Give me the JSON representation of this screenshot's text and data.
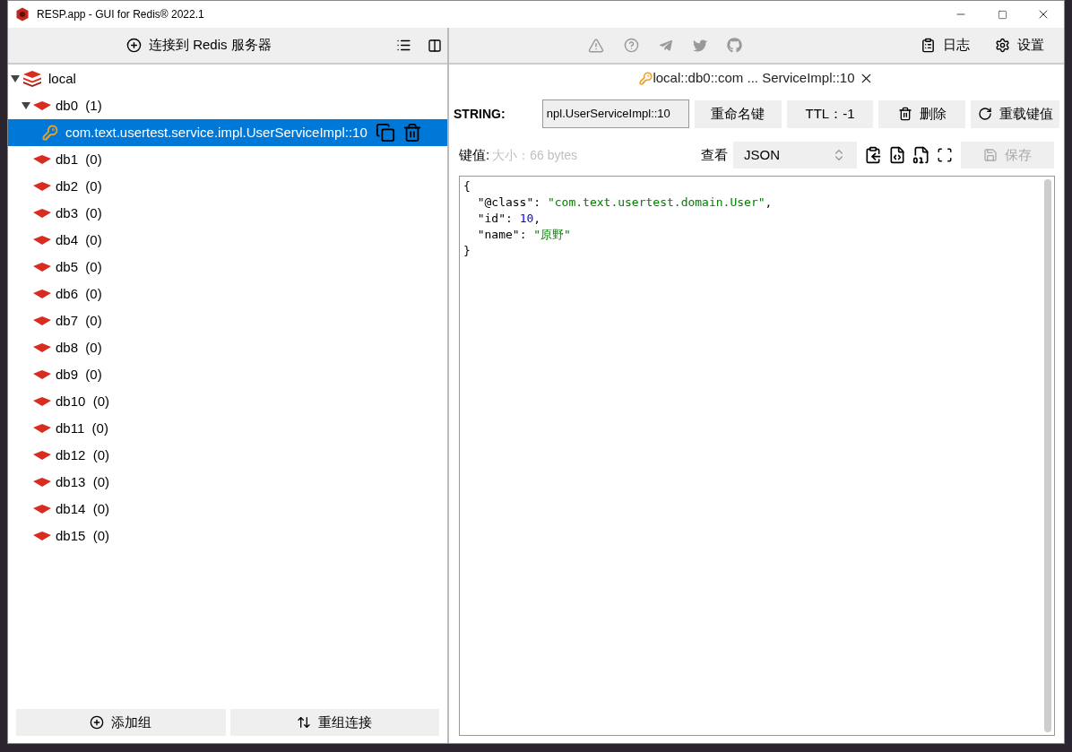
{
  "window": {
    "title": "RESP.app - GUI for Redis® 2022.1"
  },
  "left_toolbar": {
    "connect_label": "连接到 Redis 服务器"
  },
  "tree": [
    {
      "label": "local",
      "expanded": true,
      "children": [
        {
          "label": "db0",
          "count": "(1)",
          "expanded": true,
          "children": [
            {
              "label": "com.text.usertest.service.impl.UserServiceImpl::10",
              "selected": true
            }
          ]
        },
        {
          "label": "db1",
          "count": "(0)"
        },
        {
          "label": "db2",
          "count": "(0)"
        },
        {
          "label": "db3",
          "count": "(0)"
        },
        {
          "label": "db4",
          "count": "(0)"
        },
        {
          "label": "db5",
          "count": "(0)"
        },
        {
          "label": "db6",
          "count": "(0)"
        },
        {
          "label": "db7",
          "count": "(0)"
        },
        {
          "label": "db8",
          "count": "(0)"
        },
        {
          "label": "db9",
          "count": "(0)"
        },
        {
          "label": "db10",
          "count": "(0)"
        },
        {
          "label": "db11",
          "count": "(0)"
        },
        {
          "label": "db12",
          "count": "(0)"
        },
        {
          "label": "db13",
          "count": "(0)"
        },
        {
          "label": "db14",
          "count": "(0)"
        },
        {
          "label": "db15",
          "count": "(0)"
        }
      ]
    }
  ],
  "bottom_buttons": [
    {
      "kind": "add",
      "label": "添加组"
    },
    {
      "kind": "sort",
      "label": "重组连接"
    }
  ],
  "right_toolbar": {
    "buttons": [
      {
        "kind": "log",
        "label": "日志"
      },
      {
        "kind": "settings",
        "label": "设置"
      }
    ]
  },
  "tab": {
    "label": "local::db0::com ... ServiceImpl::10"
  },
  "key_row": {
    "type": "STRING:",
    "key_name": "npl.UserServiceImpl::10",
    "buttons": [
      {
        "kind": "rename",
        "label": "重命名键"
      },
      {
        "kind": "ttl",
        "label": "TTL：-1"
      },
      {
        "kind": "delete",
        "label": "删除"
      },
      {
        "kind": "reload",
        "label": "重载键值"
      }
    ]
  },
  "value_row": {
    "label": "键值:",
    "size": "大小：66 bytes",
    "view_label": "查看",
    "view_format": "JSON",
    "save": {
      "label": "保存",
      "disabled": true
    }
  },
  "editor": {
    "lines": [
      {
        "tokens": [
          {
            "kind": "punct",
            "text": "{"
          }
        ]
      },
      {
        "tokens": [
          {
            "kind": "key",
            "text": "  \"@class\""
          },
          {
            "kind": "punct",
            "text": ": "
          },
          {
            "kind": "string",
            "text": "\"com.text.usertest.domain.User\""
          },
          {
            "kind": "punct",
            "text": ","
          }
        ]
      },
      {
        "tokens": [
          {
            "kind": "key",
            "text": "  \"id\""
          },
          {
            "kind": "punct",
            "text": ": "
          },
          {
            "kind": "number",
            "text": "10"
          },
          {
            "kind": "punct",
            "text": ","
          }
        ]
      },
      {
        "tokens": [
          {
            "kind": "key",
            "text": "  \"name\""
          },
          {
            "kind": "punct",
            "text": ": "
          },
          {
            "kind": "string",
            "text": "\"原野\""
          }
        ]
      },
      {
        "tokens": [
          {
            "kind": "punct",
            "text": "}"
          }
        ]
      }
    ]
  }
}
